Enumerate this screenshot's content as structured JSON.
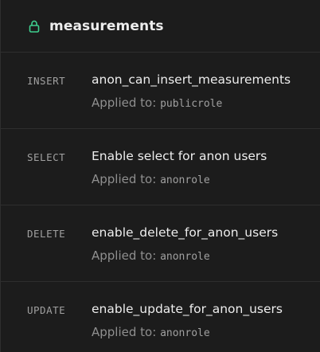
{
  "table": {
    "name": "measurements",
    "lock_icon": "lock-icon",
    "lock_color": "#3ecf8e"
  },
  "policies": [
    {
      "command": "INSERT",
      "name": "anon_can_insert_measurements",
      "applied_label": "Applied to:",
      "roles": "publicrole"
    },
    {
      "command": "SELECT",
      "name": "Enable select for anon users",
      "applied_label": "Applied to:",
      "roles": "anonrole"
    },
    {
      "command": "DELETE",
      "name": "enable_delete_for_anon_users",
      "applied_label": "Applied to:",
      "roles": "anonrole"
    },
    {
      "command": "UPDATE",
      "name": "enable_update_for_anon_users",
      "applied_label": "Applied to:",
      "roles": "anonrole"
    }
  ]
}
